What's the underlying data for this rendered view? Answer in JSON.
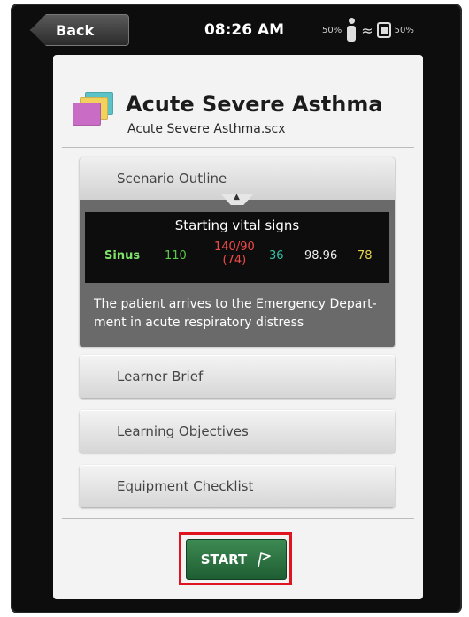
{
  "status_bar": {
    "back_label": "Back",
    "time": "08:26 AM",
    "left_percent": "50%",
    "right_percent": "50%"
  },
  "scenario": {
    "title": "Acute Severe Asthma",
    "file": "Acute Severe Asthma.scx"
  },
  "sections": {
    "outline": "Scenario Outline",
    "learner_brief": "Learner Brief",
    "objectives": "Learning Objectives",
    "equipment": "Equipment Checklist"
  },
  "vitals": {
    "title": "Starting vital signs",
    "rhythm": "Sinus",
    "hr": "110",
    "bp": "140/90",
    "map": "(74)",
    "resp": "36",
    "temp": "98.96",
    "spo2": "78"
  },
  "outline_text": "The patient arrives to the Emergency Depart-ment in acute respiratory distress",
  "start_label": "START",
  "colors": {
    "start_green": "#2f7a46",
    "highlight_red": "#e0141f",
    "bp_red": "#f04a4a",
    "rhythm_green": "#7fe36b"
  }
}
